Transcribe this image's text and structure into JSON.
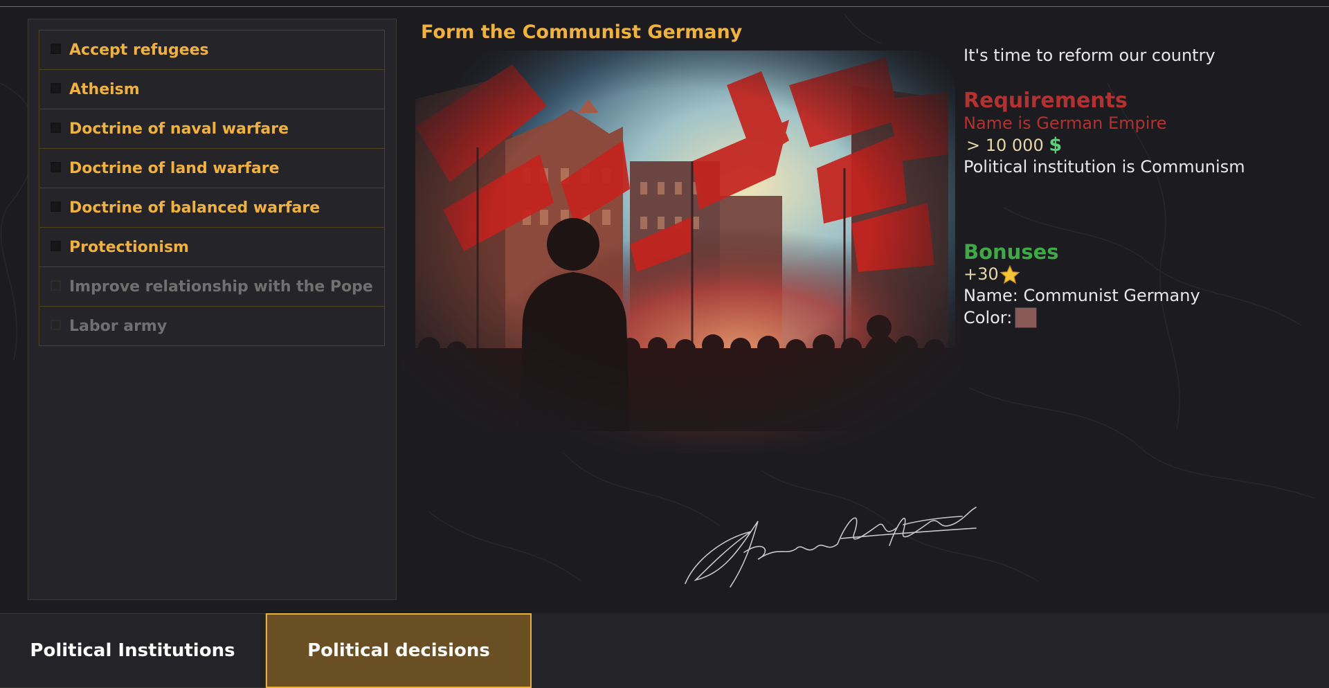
{
  "decisions": {
    "items": [
      {
        "label": "Accept refugees",
        "enabled": true
      },
      {
        "label": "Atheism",
        "enabled": true
      },
      {
        "label": "Doctrine of naval warfare",
        "enabled": true
      },
      {
        "label": "Doctrine of land warfare",
        "enabled": true
      },
      {
        "label": "Doctrine of balanced warfare",
        "enabled": true
      },
      {
        "label": "Protectionism",
        "enabled": true
      },
      {
        "label": "Improve relationship with the Pope",
        "enabled": false
      },
      {
        "label": "Labor army",
        "enabled": false
      }
    ]
  },
  "selected": {
    "title": "Form the Communist Germany",
    "description": "It's time to reform our country",
    "requirements": {
      "heading": "Requirements",
      "items": [
        {
          "text": "Name is German Empire",
          "met": false
        },
        {
          "text": "> 10 000",
          "icon": "dollar-icon",
          "met": true
        },
        {
          "text": "Political institution is Communism",
          "met": true
        }
      ]
    },
    "bonuses": {
      "heading": "Bonuses",
      "prestige": "+30",
      "prestige_icon": "star-icon",
      "name": "Name: Communist Germany",
      "color_label": "Color:",
      "color": "#8a5a58"
    }
  },
  "tabs": [
    {
      "label": "Political Institutions",
      "active": false
    },
    {
      "label": "Political decisions",
      "active": true
    }
  ],
  "colors": {
    "accent": "#f0b23a",
    "unmet": "#b5302f",
    "bonus": "#3fa847",
    "money": "#59d07a"
  }
}
